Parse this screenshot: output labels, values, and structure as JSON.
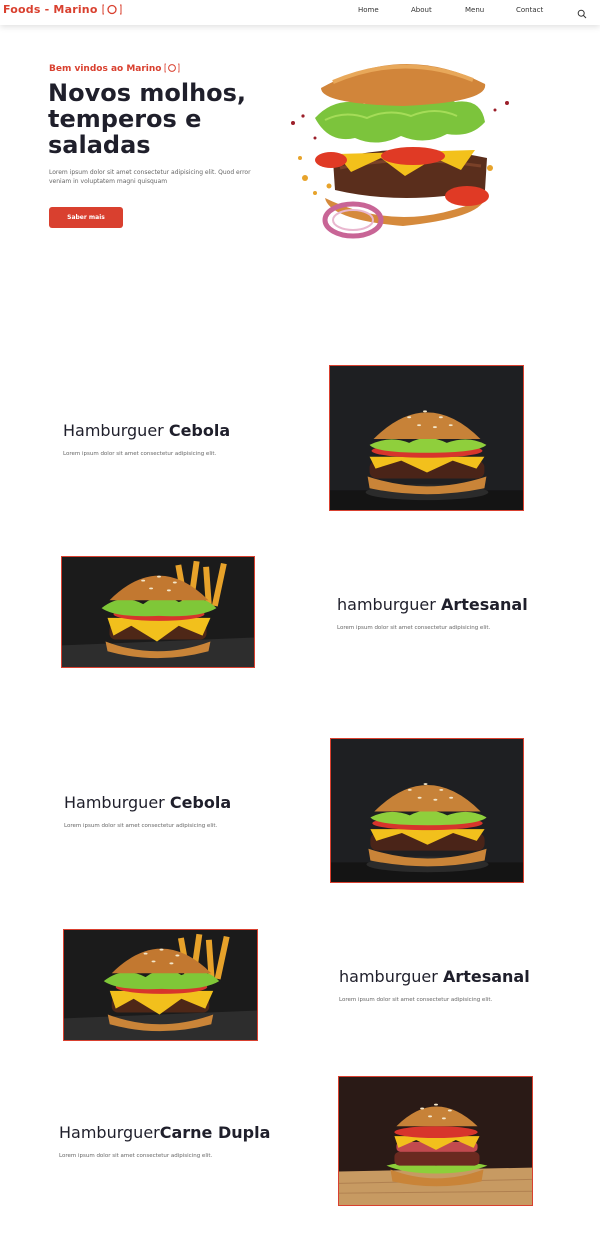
{
  "nav": {
    "brand": "Foods - Marino",
    "brand_icon": "plate-icon",
    "links": [
      "Home",
      "About",
      "Menu",
      "Contact"
    ],
    "search_icon": "search-icon"
  },
  "hero": {
    "kicker": "Bem vindos ao Marino",
    "title": "Novos molhos, temperos e saladas",
    "text": "Lorem ipsum dolor sit amet consectetur adipisicing elit. Quod error veniam in voluptatem magni quisquam",
    "button": "Saber mais"
  },
  "features": [
    {
      "title_light": "Hamburguer ",
      "title_bold": "Cebola",
      "text": "Lorem ipsum dolor sit amet consectetur adipisicing elit."
    },
    {
      "title_light": "hamburguer ",
      "title_bold": "Artesanal",
      "text": "Lorem ipsum dolor sit amet consectetur adipisicing elit."
    },
    {
      "title_light": "Hamburguer ",
      "title_bold": "Cebola",
      "text": "Lorem ipsum dolor sit amet consectetur adipisicing elit."
    },
    {
      "title_light": "hamburguer ",
      "title_bold": "Artesanal",
      "text": "Lorem ipsum dolor sit amet consectetur adipisicing elit."
    },
    {
      "title_light": "Hamburguer",
      "title_bold": "Carne Dupla",
      "text": "Lorem ipsum dolor sit amet consectetur adipisicing elit."
    }
  ],
  "colors": {
    "accent": "#d9402f",
    "heading": "#1f1f2b",
    "body_text": "#666666"
  }
}
